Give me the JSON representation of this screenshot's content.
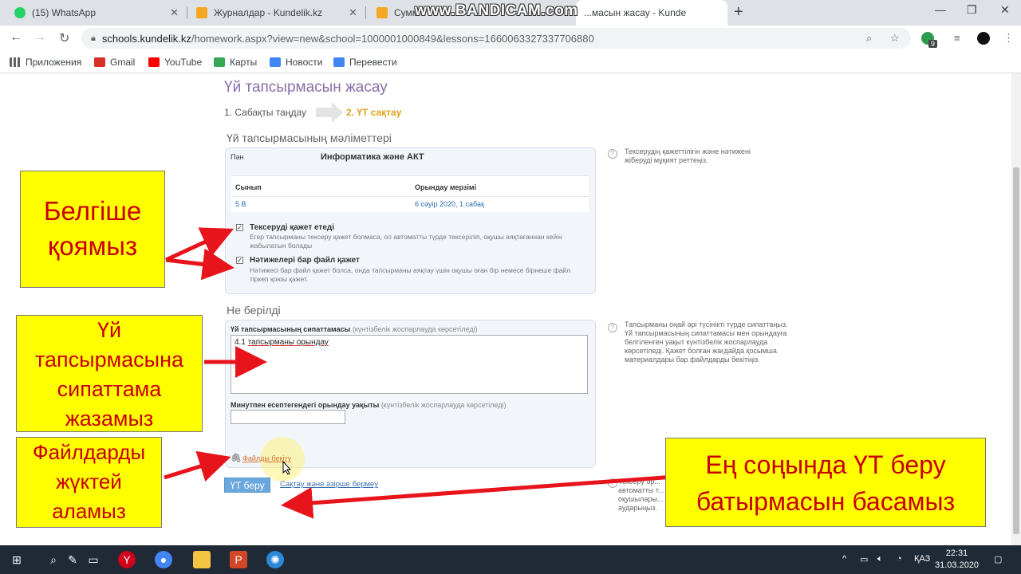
{
  "browser": {
    "tabs": [
      {
        "label": "(15) WhatsApp",
        "icon": "whatsapp-icon",
        "color": "#25d366"
      },
      {
        "label": "Журналдар - Kundelik.kz",
        "icon": "kundelik-icon",
        "color": "#f5a623"
      },
      {
        "label": "Сумм",
        "icon": "kundelik-icon",
        "color": "#f5a623"
      },
      {
        "label": "...масын жасау - Kunde",
        "icon": "kundelik-icon",
        "color": "#f5a623"
      }
    ],
    "watermark": "www.BANDICAM.com",
    "url_host": "schools.kundelik.kz",
    "url_path": "/homework.aspx?view=new&school=1000001000849&lessons=1660063327337706880",
    "extension_badge": "9",
    "bookmarks": [
      {
        "label": "Приложения",
        "icon": "apps-grid-icon",
        "color": "#5f6368"
      },
      {
        "label": "Gmail",
        "icon": "gmail-icon",
        "color": "#d93025"
      },
      {
        "label": "YouTube",
        "icon": "youtube-icon",
        "color": "#ff0000"
      },
      {
        "label": "Карты",
        "icon": "maps-icon",
        "color": "#34a853"
      },
      {
        "label": "Новости",
        "icon": "news-icon",
        "color": "#4285f4"
      },
      {
        "label": "Перевести",
        "icon": "translate-icon",
        "color": "#4285f4"
      }
    ]
  },
  "page": {
    "title": "Үй тапсырмасын жасау",
    "steps": {
      "step1": "1. Сабақты таңдау",
      "step2": "2. ҮТ сақтау"
    },
    "details": {
      "section_title": "Үй тапсырмасының мәліметтері",
      "subject_label": "Пән",
      "subject_value": "Информатика және АКТ",
      "class_label": "Сынып",
      "due_label": "Орындау мерзімі",
      "class_value": "5 В",
      "due_value": "6 сәуір 2020, 1 сабақ",
      "check_label": "Тексеруді қажет етеді",
      "check_hint": "Егер тапсырманы тексеру қажет болмаса, ол автоматты түрде тексеріліп, оқушы аяқтағаннан кейін жабылатын болады",
      "file_label": "Нәтижелері бар файл қажет",
      "file_hint": "Нәтижесі бар файл қажет болса, онда тапсырманы аяқтау үшін оқушы оған бір немесе бірнеше файл тіркеп қоюы қажет.",
      "side_hint": "Тексерудің қажеттілігін және нәтижені жіберуді мұқият реттеңіз."
    },
    "given": {
      "section_title": "Не берілді",
      "desc_label": "Үй тапсырмасының сипаттамасы",
      "desc_note": "(күнтізбелік жоспарлауда көрсетіледі)",
      "desc_value_pre": "4.1 ",
      "desc_value_ul": "тапсырманы орындау",
      "time_label": "Минутпен есептегендегі орындау уақыты",
      "time_note": "(күнтізбелік жоспарлауда көрсетіледі)",
      "attach_link": "Файлды бекіту",
      "side_hint": "Тапсырманы оңай әрі түсінікті түрде сипаттаңыз. Үй тапсырмасының сипаттамасы мен орындауға белгіленген уақыт күнтізбелік жоспарлауда көрсетіледі. Қажет болған жағдайда қосымша материалдары бар файлдарды бекітіңіз."
    },
    "submit_button": "ҮТ беру",
    "save_link": "Сақтау және әзірше бермеу",
    "bottom_hint": "Тексеру әр... автоматты т... оқушылары... аударыңыз."
  },
  "annotations": {
    "checkbox_note": [
      "Белгіше",
      "қоямыз"
    ],
    "description_note": [
      "Үй",
      "тапсырмасына",
      "сипаттама",
      "жазамыз"
    ],
    "files_note": [
      "Файлдарды",
      "жүктей",
      "аламыз"
    ],
    "submit_note": [
      "Ең соңында ҮТ беру",
      "батырмасын басамыз"
    ],
    "note_bg": "#ffff00",
    "note_text": "#c80000",
    "arrow_color": "#e8141c"
  },
  "taskbar": {
    "time": "22:31",
    "date": "31.03.2020",
    "lang": "ҚАЗ"
  }
}
